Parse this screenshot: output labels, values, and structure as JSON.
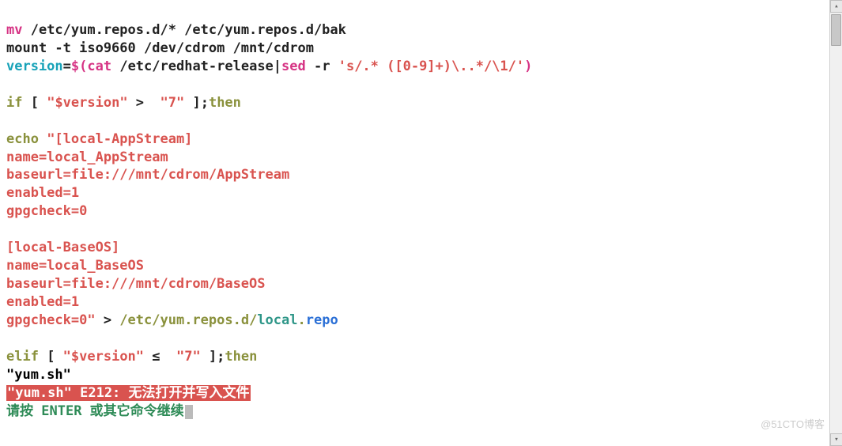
{
  "lines": {
    "l01_cmd": "mv",
    "l01_arg": " /etc/yum.repos.d/* /etc/yum.repos.d/bak",
    "l02": "mount -t iso9660 /dev/cdrom /mnt/cdrom",
    "l03_var": "version",
    "l03_eq": "=",
    "l03_cmd": "$(cat",
    "l03_arg": " /etc/redhat-release",
    "l03_pipe": "|",
    "l03_sed": "sed",
    "l03_opt": " -r",
    "l03_regex": " 's/.* ([0-9]+)\\..*/\\1/'",
    "l03_close": ")",
    "l05_if": "if",
    "l05_b1": " [ ",
    "l05_str1": "\"$version\"",
    "l05_op": " > ",
    "l05_str2": " \"7\"",
    "l05_b2": " ];",
    "l05_then": "then",
    "l07_echo": "echo",
    "l07_s": " \"[local-AppStream]",
    "l08": "name=local_AppStream",
    "l09": "baseurl=file:///mnt/cdrom/AppStream",
    "l10": "enabled=1",
    "l11": "gpgcheck=0",
    "l13": "[local-BaseOS]",
    "l14": "name=local_BaseOS",
    "l15": "baseurl=file:///mnt/cdrom/BaseOS",
    "l16": "enabled=1",
    "l17_a": "gpgcheck=0\"",
    "l17_b": " > ",
    "l17_path": "/etc/yum.repos.d/",
    "l17_file": "local",
    "l17_dot": ".",
    "l17_ext": "repo",
    "l19_elif": "elif",
    "l19_b1": " [ ",
    "l19_str1": "\"$version\"",
    "l19_op": " ≤ ",
    "l19_str2": " \"7\"",
    "l19_b2": " ];",
    "l19_then": "then",
    "l20": "\"yum.sh\"",
    "l21_err": "\"yum.sh\" E212: 无法打开并写入文件",
    "l22_a": "请按 ",
    "l22_b": "ENTER",
    "l22_c": " 或其它命令继续"
  },
  "watermark": "@51CTO博客"
}
